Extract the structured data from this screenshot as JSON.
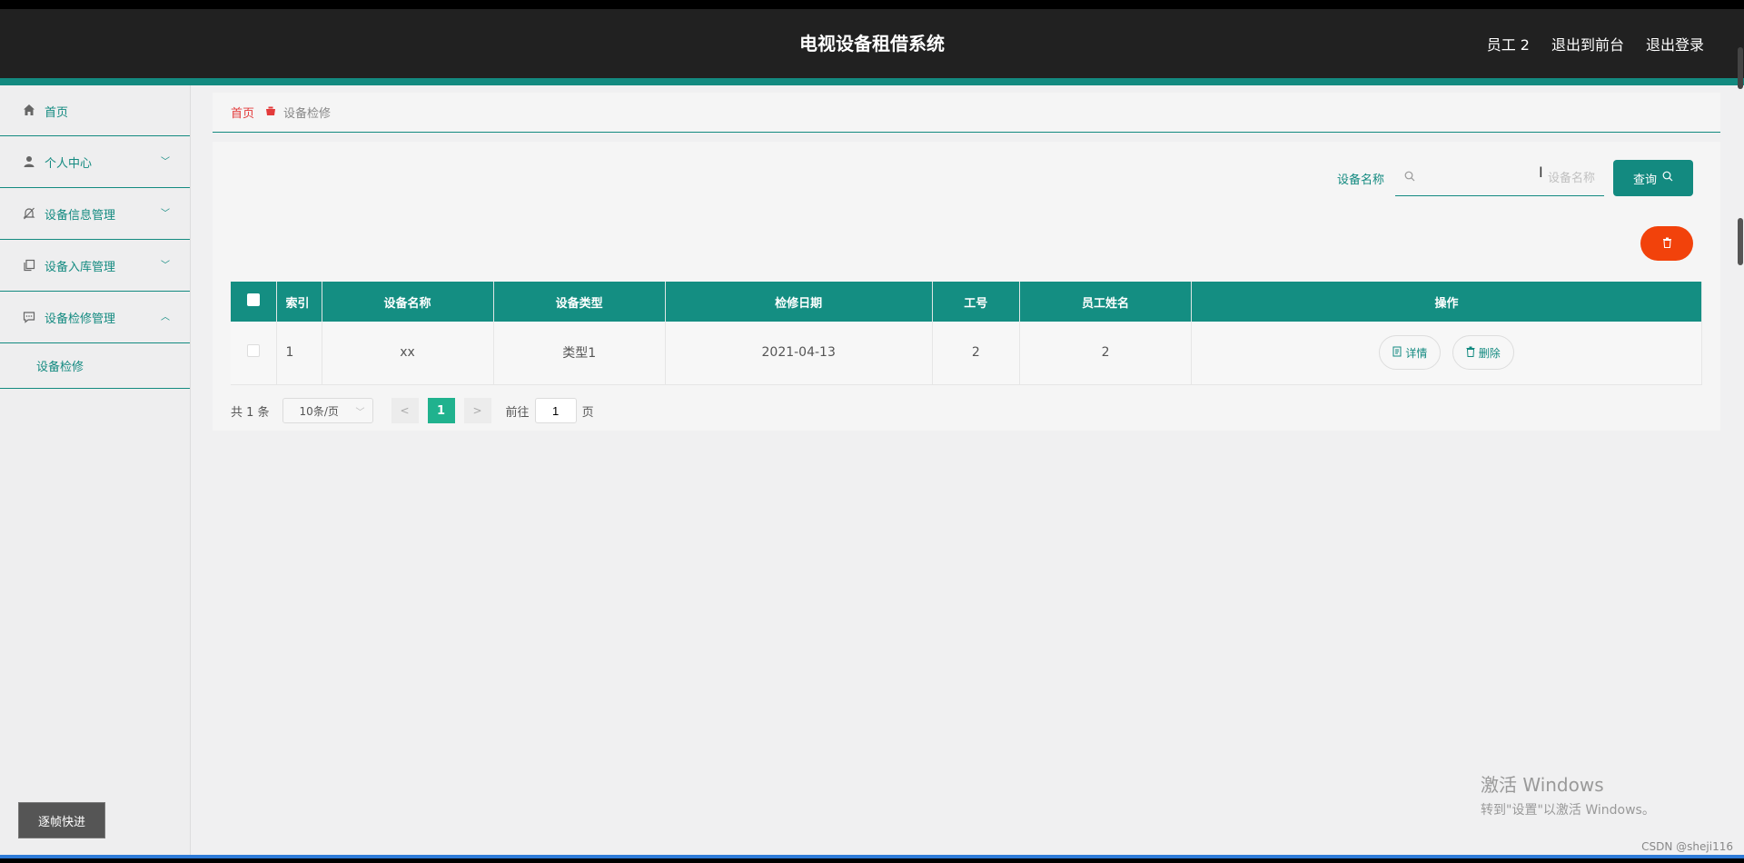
{
  "app": {
    "title": "电视设备租借系统"
  },
  "header": {
    "links": [
      "员工 2",
      "退出到前台",
      "退出登录"
    ]
  },
  "sidebar": {
    "items": [
      {
        "label": "首页",
        "icon": "home-icon"
      },
      {
        "label": "个人中心",
        "icon": "user-icon",
        "arrow": "chevron-down-icon"
      },
      {
        "label": "设备信息管理",
        "icon": "bell-off-icon",
        "arrow": "chevron-down-icon"
      },
      {
        "label": "设备入库管理",
        "icon": "copy-icon",
        "arrow": "chevron-down-icon"
      },
      {
        "label": "设备检修管理",
        "icon": "chat-icon",
        "arrow": "chevron-up-icon"
      }
    ],
    "submenu": "设备检修",
    "frame_button": "逐帧快进"
  },
  "breadcrumb": {
    "home": "首页",
    "current": "设备检修"
  },
  "search": {
    "label": "设备名称",
    "placeholder": "设备名称",
    "value": "",
    "button": "查询"
  },
  "table": {
    "columns": [
      "索引",
      "设备名称",
      "设备类型",
      "检修日期",
      "工号",
      "员工姓名",
      "操作"
    ],
    "rows": [
      {
        "index": "1",
        "name": "xx",
        "type": "类型1",
        "date": "2021-04-13",
        "emp_no": "2",
        "emp_name": "2"
      }
    ],
    "actions": {
      "detail": "详情",
      "delete": "删除"
    }
  },
  "pagination": {
    "total": "共 1 条",
    "page_size": "10条/页",
    "current_page": "1",
    "goto_prefix": "前往",
    "goto_value": "1",
    "goto_suffix": "页"
  },
  "watermark": {
    "line1": "激活 Windows",
    "line2": "转到\"设置\"以激活 Windows。"
  },
  "credit": "CSDN @sheji116",
  "colors": {
    "header_bg": "#212121",
    "accent": "#138a80",
    "table_header": "#148e82",
    "danger": "#f2420b",
    "page_active": "#20b28e"
  }
}
